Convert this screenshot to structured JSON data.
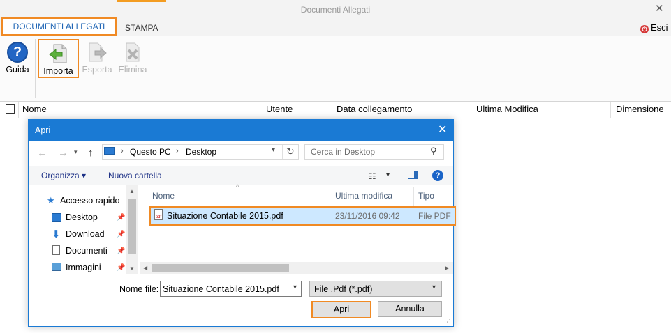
{
  "app": {
    "title": "Documenti Allegati",
    "close_glyph": "✕",
    "tabs": [
      "DOCUMENTI ALLEGATI",
      "STAMPA"
    ],
    "exit_label": "Esci"
  },
  "ribbon": {
    "guida": "Guida",
    "importa": "Importa",
    "esporta": "Esporta",
    "elimina": "Elimina"
  },
  "grid": {
    "columns": [
      "Nome",
      "Utente",
      "Data collegamento",
      "Ultima Modifica",
      "Dimensione"
    ]
  },
  "dialog": {
    "title": "Apri",
    "close_glyph": "✕",
    "breadcrumb": [
      "Questo PC",
      "Desktop"
    ],
    "search_placeholder": "Cerca in Desktop",
    "organize_label": "Organizza ▾",
    "new_folder_label": "Nuova cartella",
    "nav_items": [
      {
        "label": "Accesso rapido",
        "icon": "star-icon"
      },
      {
        "label": "Desktop",
        "icon": "desktop-icon"
      },
      {
        "label": "Download",
        "icon": "download-icon"
      },
      {
        "label": "Documenti",
        "icon": "documents-icon"
      },
      {
        "label": "Immagini",
        "icon": "pictures-icon"
      }
    ],
    "list_columns": [
      "Nome",
      "Ultima modifica",
      "Tipo"
    ],
    "files": [
      {
        "name": "Situazione Contabile 2015.pdf",
        "modified": "23/11/2016 09:42",
        "type": "File PDF",
        "selected": true
      }
    ],
    "filename_label": "Nome file:",
    "filename_value": "Situazione Contabile 2015.pdf",
    "filter_value": "File .Pdf (*.pdf)",
    "open_label": "Apri",
    "cancel_label": "Annulla"
  },
  "colors": {
    "accent_blue": "#1a7ad4",
    "highlight_orange": "#f08a24",
    "selection_bg": "#cde8ff"
  }
}
